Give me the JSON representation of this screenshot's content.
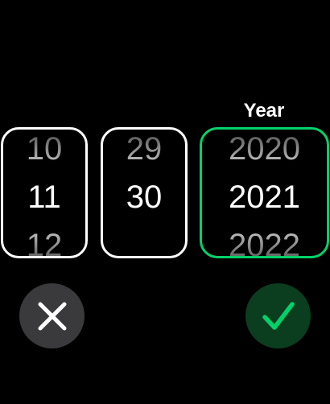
{
  "picker": {
    "label": "Year",
    "month": {
      "prev": "10",
      "current": "11",
      "next": "12"
    },
    "day": {
      "prev": "29",
      "current": "30",
      "next": ""
    },
    "year": {
      "prev": "2020",
      "current": "2021",
      "next": "2022"
    }
  },
  "buttons": {
    "cancel_icon": "close-icon",
    "confirm_icon": "checkmark-icon"
  },
  "colors": {
    "background": "#000000",
    "accent": "#00d26a",
    "confirm_bg": "#0b3d1f",
    "cancel_bg": "#3a3a3c"
  }
}
